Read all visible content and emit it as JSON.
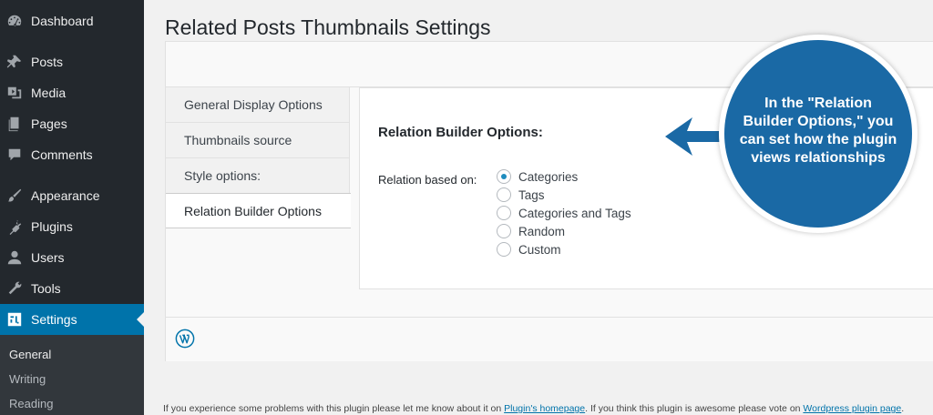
{
  "sidebar": {
    "items": [
      {
        "label": "Dashboard",
        "icon": "dashboard-icon"
      },
      {
        "label": "Posts",
        "icon": "pin-icon"
      },
      {
        "label": "Media",
        "icon": "media-icon"
      },
      {
        "label": "Pages",
        "icon": "pages-icon"
      },
      {
        "label": "Comments",
        "icon": "comment-icon"
      },
      {
        "label": "Appearance",
        "icon": "paintbrush-icon"
      },
      {
        "label": "Plugins",
        "icon": "plugin-icon"
      },
      {
        "label": "Users",
        "icon": "user-icon"
      },
      {
        "label": "Tools",
        "icon": "wrench-icon"
      },
      {
        "label": "Settings",
        "icon": "settings-icon"
      }
    ],
    "submenu": [
      "General",
      "Writing",
      "Reading"
    ]
  },
  "page": {
    "title": "Related Posts Thumbnails Settings"
  },
  "tabs": [
    {
      "label": "General Display Options"
    },
    {
      "label": "Thumbnails source"
    },
    {
      "label": "Style options:"
    },
    {
      "label": "Relation Builder Options"
    }
  ],
  "content": {
    "section_title": "Relation Builder Options:",
    "field_label": "Relation based on:",
    "options": [
      {
        "label": "Categories",
        "checked": true
      },
      {
        "label": "Tags",
        "checked": false
      },
      {
        "label": "Categories and Tags",
        "checked": false
      },
      {
        "label": "Random",
        "checked": false
      },
      {
        "label": "Custom",
        "checked": false
      }
    ]
  },
  "footer": {
    "text_1": "If you experience some problems with this plugin please let me know about it on ",
    "link_1": "Plugin's homepage",
    "text_2": ". If you think this plugin is awesome please vote on ",
    "link_2": "Wordpress plugin page",
    "text_3": "."
  },
  "callout": {
    "text": "In the \"Relation Builder Options,\" you can set how the plugin views relationships"
  },
  "colors": {
    "sidebar_bg": "#23282d",
    "accent": "#0073aa",
    "callout_bg": "#1a69a5"
  }
}
